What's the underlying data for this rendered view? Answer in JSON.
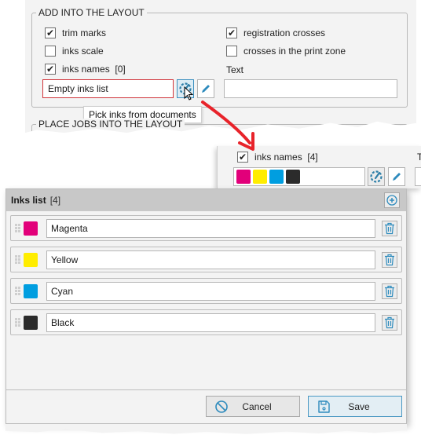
{
  "layout_panel": {
    "group_title": "ADD INTO THE LAYOUT",
    "checkboxes": [
      {
        "label": "trim marks",
        "checked": true
      },
      {
        "label": "inks scale",
        "checked": false
      },
      {
        "label": "inks names  [0]",
        "checked": true
      },
      {
        "label": "registration crosses",
        "checked": true
      },
      {
        "label": "crosses in the print zone",
        "checked": false
      }
    ],
    "inks_field_value": "Empty inks list",
    "text_label": "Text",
    "text_value": "",
    "tooltip": "Pick inks from documents",
    "next_group_title": "PLACE JOBS INTO THE LAYOUT",
    "icons": {
      "pick": "pick-inks-icon",
      "edit": "pencil-icon"
    }
  },
  "result_snippet": {
    "checkbox_label": "inks names  [4]",
    "checked": true,
    "text_label_partial": "T",
    "swatches": [
      "#e2007a",
      "#ffed00",
      "#009ee0",
      "#2b2b2b"
    ]
  },
  "inks_dialog": {
    "title": "Inks list",
    "count": "[4]",
    "inks": [
      {
        "name": "Magenta",
        "color": "#e2007a"
      },
      {
        "name": "Yellow",
        "color": "#ffed00"
      },
      {
        "name": "Cyan",
        "color": "#009ee0"
      },
      {
        "name": "Black",
        "color": "#2b2b2b"
      }
    ],
    "cancel_label": "Cancel",
    "save_label": "Save"
  },
  "colors": {
    "accent": "#2e8bbd",
    "error_border": "#d0343a",
    "arrow": "#e8232a"
  }
}
